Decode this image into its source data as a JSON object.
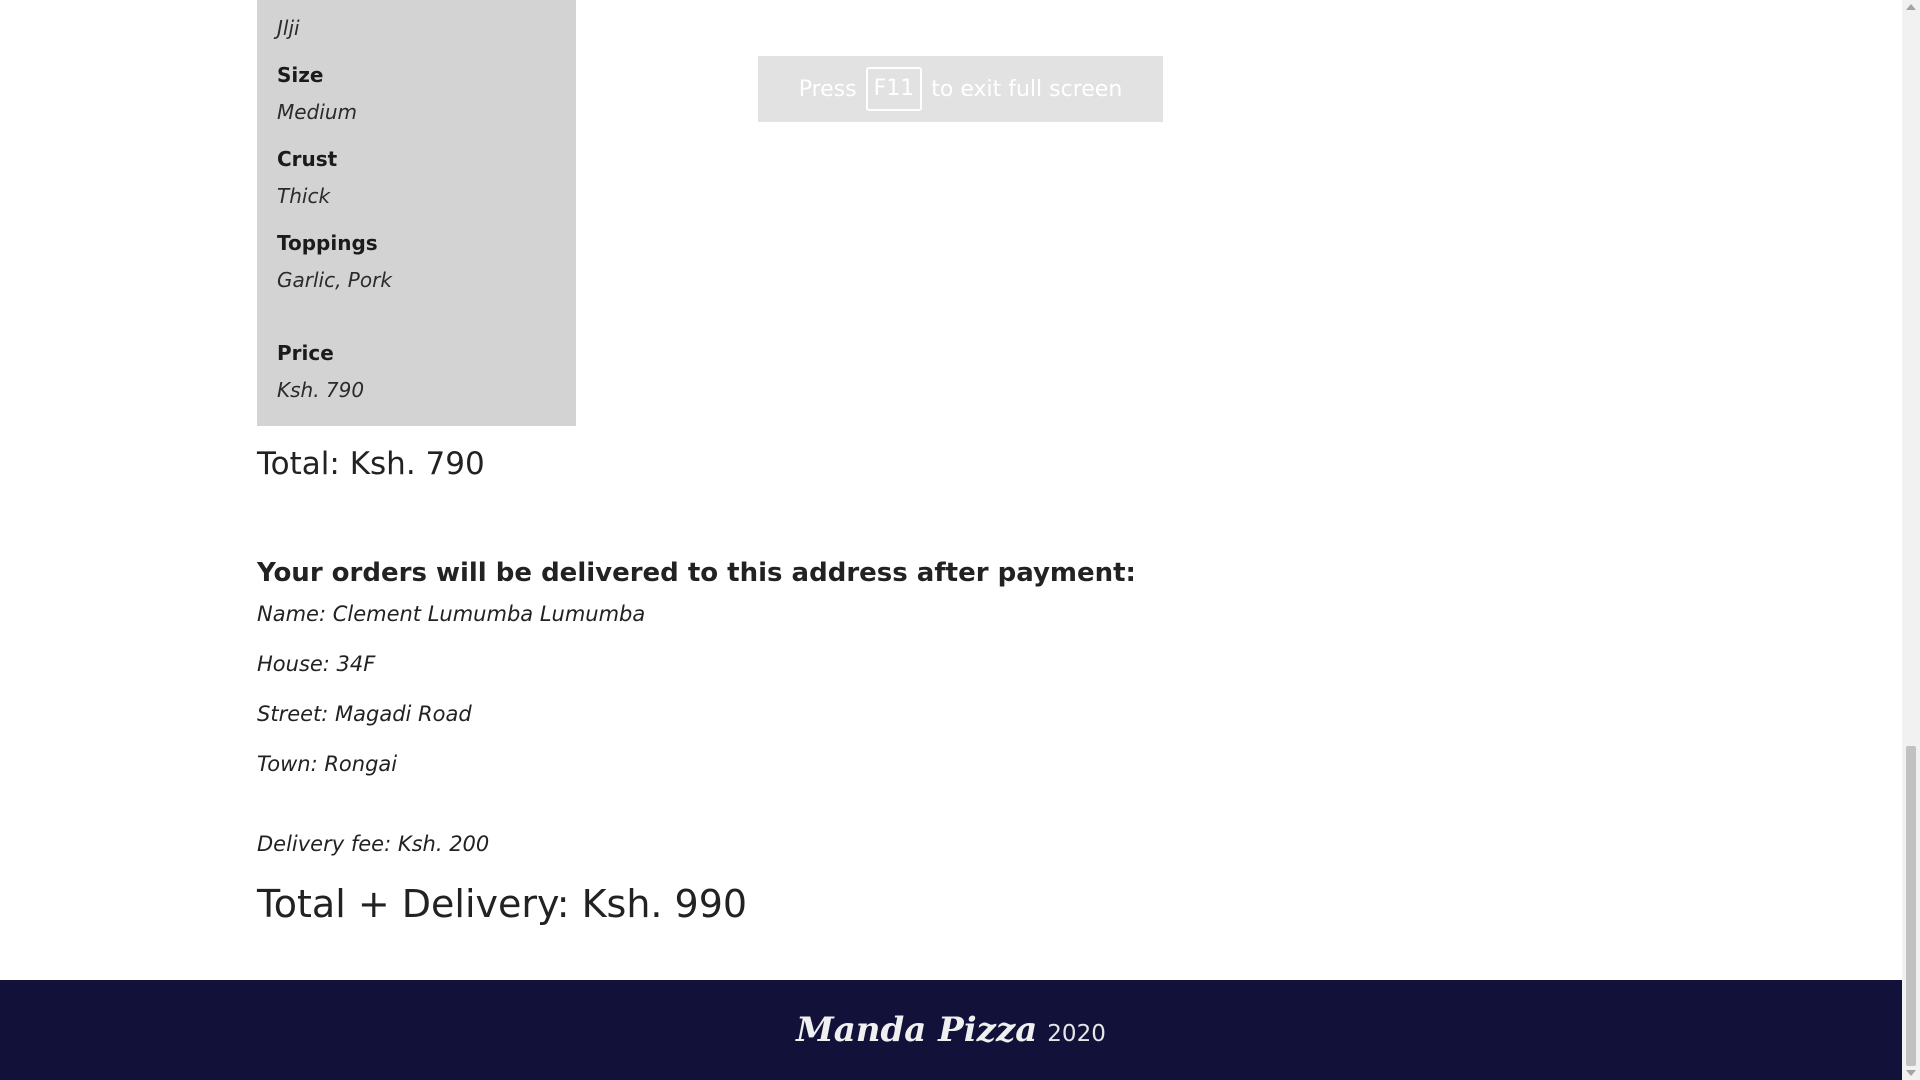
{
  "order": {
    "name_value": "Jlji",
    "size_label": "Size",
    "size_value": "Medium",
    "crust_label": "Crust",
    "crust_value": "Thick",
    "toppings_label": "Toppings",
    "toppings_value": "Garlic, Pork",
    "price_label": "Price",
    "price_value": "Ksh. 790"
  },
  "fullscreen_notice": {
    "press": "Press",
    "key": "F11",
    "rest": "to exit full screen"
  },
  "total": "Total: Ksh. 790",
  "delivery": {
    "heading": "Your orders will be delivered to this address after payment:",
    "name": "Name: Clement Lumumba Lumumba",
    "house": "House: 34F",
    "street": "Street: Magadi Road",
    "town": "Town: Rongai",
    "fee": "Delivery fee: Ksh. 200"
  },
  "grand_total": "Total + Delivery: Ksh. 990",
  "footer": {
    "brand": "Manda Pizza",
    "year": "2020"
  },
  "colors": {
    "card_bg": "#d3d3d3",
    "footer_bg": "#12113a"
  }
}
